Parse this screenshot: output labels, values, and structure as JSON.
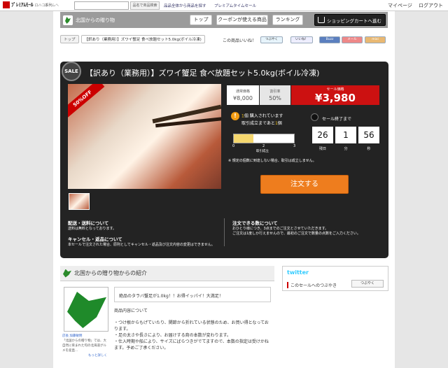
{
  "header": {
    "logo_main": "ﾌﾟﾚﾐｱﾑﾓｰﾙ",
    "logo_sub": "ロハコ系列",
    "home_label": "ホームへ",
    "search_placeholder": "",
    "search_button": "品名で商品検索",
    "links": [
      "品品全体から商品を探す",
      "プレミアムタイムセール"
    ],
    "right_links": [
      "マイページ",
      "ログアウト"
    ]
  },
  "nav": {
    "shop_name": "北国からの贈り物",
    "buttons": [
      "トップ",
      "クーポンが使える商品",
      "ランキング"
    ],
    "cart": "ショッピングカートへ進む"
  },
  "breadcrumb": {
    "home": "トップ",
    "current": "【訳あり（業務用）】ズワイ蟹足 食べ放題セット5.0kg(ボイル冷凍)"
  },
  "share": {
    "label": "この商品いいね！",
    "buttons": [
      "つぶやく",
      "いいね！",
      "Buzz",
      "メール",
      "mixi"
    ]
  },
  "product": {
    "sale_badge": "SALE",
    "title": "【訳あり（業務用）】ズワイ蟹足 食べ放題セット5.0kg(ボイル冷凍)",
    "discount_ribbon": "50%OFF",
    "regular_label": "通常価格",
    "regular_price": "¥8,000",
    "discount_label": "割引率",
    "discount_rate": "50%",
    "sale_label": "セール価格",
    "sale_price": "¥3,980"
  },
  "purchase": {
    "bought_count": "1",
    "bought_text": "個 購入されています",
    "remain_prefix": "取引成立まであと",
    "remain_count": "1",
    "remain_suffix": "個",
    "gauge_fraction": 0.33,
    "gauge_ticks": [
      "0",
      "2",
      "3"
    ],
    "gauge_mid_label": "取引成立",
    "note": "※ 規定の個数に到達しない場合、取引は成立しません。"
  },
  "timer": {
    "label": "セール終了まで",
    "days": "26",
    "hours": "1",
    "minutes": "56",
    "days_label": "残日",
    "hours_label": "分",
    "minutes_label": "秒"
  },
  "order_button": "注文する",
  "info": {
    "shipping_head": "配送・送料について",
    "shipping_text": "送料は無料となっております。",
    "cancel_head": "キャンセル・返品について",
    "cancel_text": "本セールで注文された場合、原則としてキャンセル・返品及び注文内容の変更はできません。",
    "qty_head": "注文できる数について",
    "qty_text1": "おひとり様につき、3点までのご注文とさせていただきます。",
    "qty_text2": "ご注文は1度しか行えませんので、最初のご注文で数量の点数をご入力ください。"
  },
  "intro": {
    "heading": "北国からの贈り物からの紹介",
    "shop_caption_name": "店長 加藤敏明",
    "shop_caption": "「北国からの贈り物」では、大自然に育まれた旬の北海道グルメを産直...",
    "more": "もっと詳しく",
    "lead": "絶品のタラバ蟹足が1.0kg！！お得イッパイ！大満足！",
    "section_label": "商品内容について",
    "bullets": [
      "・つけ根からもげていたり、関節から折れている状態のため、お買い得となっております。",
      "・足の太さや長さにより、お届けする商の本数が変わります。",
      "・仕入時期や船により、サイズにばらつきがでてますので、本数の指定は受けかねます。予めご了承ください。"
    ]
  },
  "twitter": {
    "logo": "twitter",
    "line": "このセールへのつぶやき",
    "button": "つぶやく"
  }
}
